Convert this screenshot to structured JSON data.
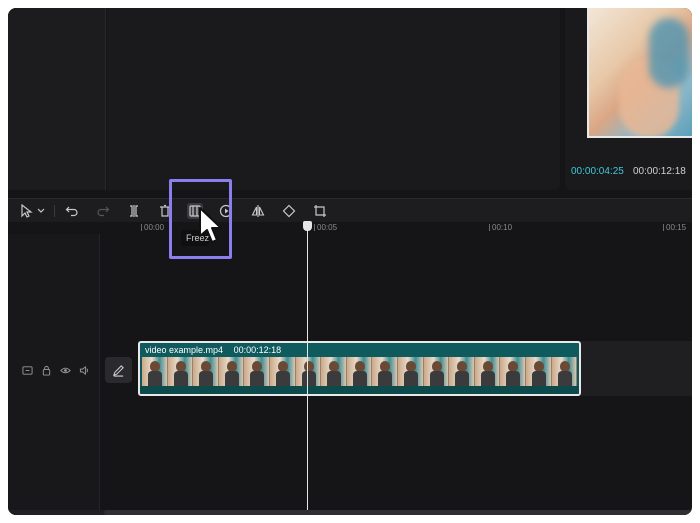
{
  "player": {
    "current_time": "00:00:04:25",
    "total_time": "00:00:12:18"
  },
  "toolbar": {
    "tools": [
      "select-icon",
      "chevron-down-icon",
      "undo-icon",
      "redo-icon",
      "split-icon",
      "delete-icon",
      "freeze-icon",
      "play-circle-icon",
      "mirror-icon",
      "rotate-icon",
      "crop-icon"
    ],
    "freeze_tooltip": "Freeze"
  },
  "ruler": {
    "labels": [
      "00:00",
      "00:05",
      "00:10",
      "00:15"
    ]
  },
  "track": {
    "clip_name": "video example.mp4",
    "clip_duration": "00:00:12:18",
    "controls": [
      "cover-icon",
      "lock-icon",
      "eye-icon",
      "speaker-icon"
    ]
  },
  "colors": {
    "accent_time": "#3ec8d6",
    "clip_bg": "#0f5a5c",
    "highlight": "#8b7ff0"
  }
}
